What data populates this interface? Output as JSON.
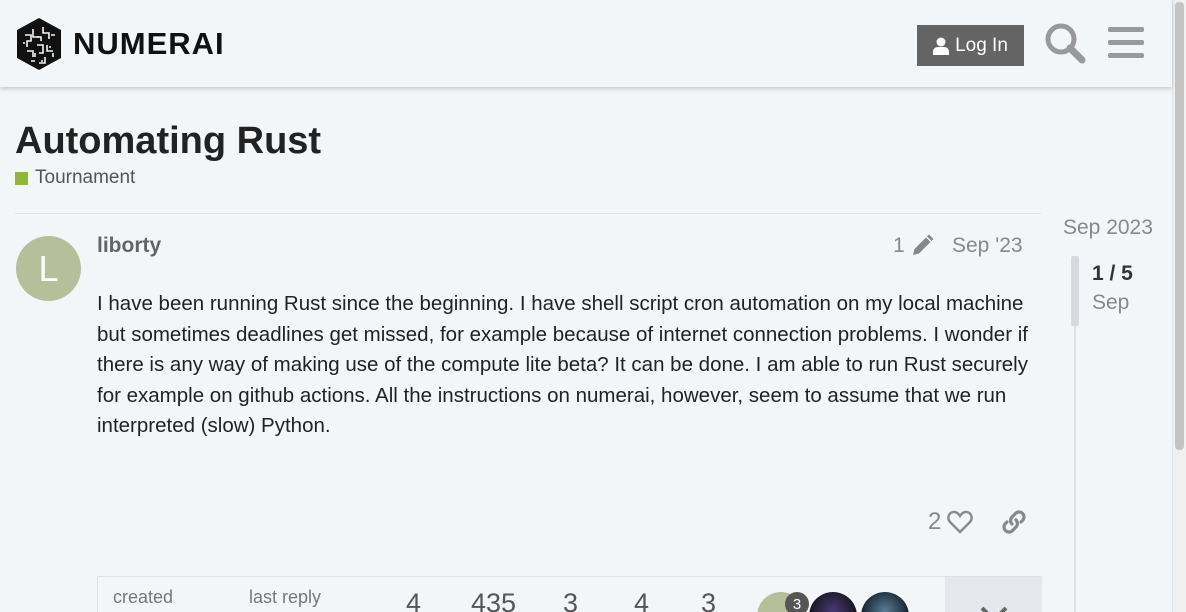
{
  "header": {
    "logo_text": "NUMERAI",
    "login_label": "Log In"
  },
  "topic": {
    "title": "Automating Rust",
    "category": "Tournament",
    "category_color": "#8eb63c"
  },
  "post": {
    "avatar_letter": "L",
    "avatar_color": "#b5bf9a",
    "username": "liborty",
    "edit_count": "1",
    "date": "Sep '23",
    "body": "I have been running Rust since the beginning. I have shell script cron automation on my local machine but sometimes deadlines get missed, for example because of internet connection problems. I wonder if there is any way of making use of the compute lite beta? It can be done. I am able to run Rust securely for example on github actions. All the instructions on numerai, however, seem to assume that we run interpreted (slow) Python.",
    "likes": "2"
  },
  "topic_map": {
    "created_label": "created",
    "last_reply_label": "last reply",
    "stats": [
      "4",
      "435",
      "3",
      "4",
      "3"
    ],
    "avatar_badge": "3"
  },
  "timeline": {
    "top_date": "Sep 2023",
    "position": "1 / 5",
    "current_date": "Sep"
  },
  "icons": [
    "user-icon",
    "search-icon",
    "hamburger-icon",
    "pencil-icon",
    "heart-icon",
    "link-icon",
    "chevron-down-icon"
  ]
}
